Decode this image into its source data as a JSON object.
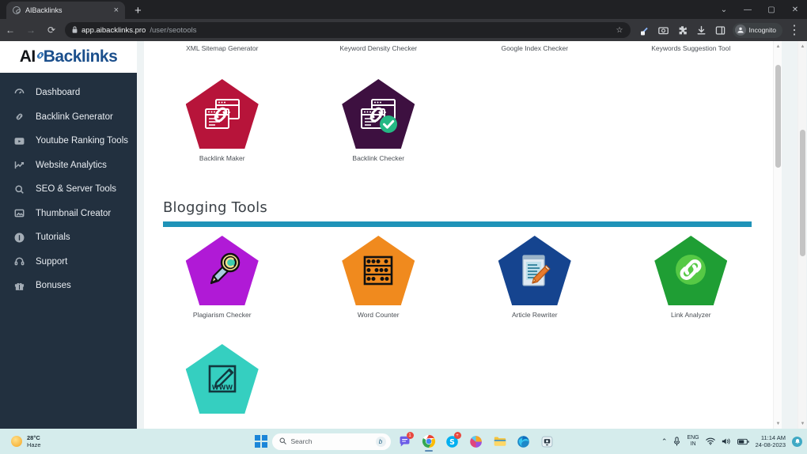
{
  "browser": {
    "tab": {
      "title": "AIBacklinks",
      "favicon_icon": "link-favicon",
      "close_icon": "×"
    },
    "newtab_label": "+",
    "window_controls": [
      {
        "name": "tab-search",
        "glyph": "⌄"
      },
      {
        "name": "minimize",
        "glyph": "—"
      },
      {
        "name": "maximize",
        "glyph": "▢"
      },
      {
        "name": "close",
        "glyph": "✕"
      }
    ],
    "nav": {
      "back": "←",
      "forward": "→",
      "reload": "⟳"
    },
    "omnibox": {
      "lock_icon": "🔒",
      "host": "app.aibacklinks.pro",
      "path": "/user/seotools",
      "star_icon": "☆"
    },
    "toolbar_icons": [
      {
        "name": "edit-pencil-icon",
        "glyph": "✎"
      },
      {
        "name": "camera-icon",
        "glyph": "▣"
      },
      {
        "name": "extensions-puzzle-icon",
        "glyph": "✦"
      },
      {
        "name": "downloads-icon",
        "glyph": "⤓"
      },
      {
        "name": "split-screen-icon",
        "glyph": "▯"
      }
    ],
    "incognito": {
      "label": "Incognito",
      "avatar_icon": "incognito-avatar"
    },
    "menu_icon": "⋮"
  },
  "app": {
    "brand": {
      "prefix": "AI",
      "chain_icon": "link-chain-icon",
      "suffix": "Backlinks"
    },
    "sidebar": {
      "items": [
        {
          "label": "Dashboard",
          "icon": "dashboard-icon"
        },
        {
          "label": "Backlink Generator",
          "icon": "link-icon"
        },
        {
          "label": "Youtube Ranking Tools",
          "icon": "video-icon"
        },
        {
          "label": "Website Analytics",
          "icon": "chart-line-icon"
        },
        {
          "label": "SEO & Server Tools",
          "icon": "search-icon"
        },
        {
          "label": "Thumbnail Creator",
          "icon": "image-icon"
        },
        {
          "label": "Tutorials",
          "icon": "info-icon"
        },
        {
          "label": "Support",
          "icon": "headset-icon"
        },
        {
          "label": "Bonuses",
          "icon": "gift-icon"
        }
      ]
    },
    "seo_tools_labels": [
      "XML Sitemap Generator",
      "Keyword Density Checker",
      "Google Index Checker",
      "Keywords Suggestion Tool"
    ],
    "backlink_tiles": [
      {
        "label": "Backlink Maker",
        "color": "#b7143a",
        "icon": "backlink-maker-icon"
      },
      {
        "label": "Backlink Checker",
        "color": "#3d1040",
        "icon": "backlink-checker-icon",
        "badge_color": "#25b884"
      }
    ],
    "blogging_section": {
      "title": "Blogging Tools",
      "rule_color": "#1f93b8",
      "tiles": [
        {
          "label": "Plagiarism Checker",
          "color": "#b01ad6",
          "icon": "magnifier-pencil-icon"
        },
        {
          "label": "Word Counter",
          "color": "#f08a1e",
          "icon": "abacus-icon"
        },
        {
          "label": "Article Rewriter",
          "color": "#15448f",
          "icon": "document-pencil-icon"
        },
        {
          "label": "Link Analyzer",
          "color": "#1f9e34",
          "icon": "chain-circle-icon"
        },
        {
          "label": "",
          "color": "#35cfc0",
          "icon": "pencil-www-icon"
        }
      ]
    }
  },
  "taskbar": {
    "weather": {
      "temperature": "28°C",
      "condition": "Haze",
      "icon": "sun-icon"
    },
    "start_icon": "windows-logo",
    "search": {
      "placeholder": "Search",
      "icon": "search-icon",
      "bing_icon": "bing-icon"
    },
    "apps": [
      {
        "name": "chat-teams-icon",
        "badge": "1"
      },
      {
        "name": "google-chrome-icon",
        "badge": ""
      },
      {
        "name": "skype-icon",
        "badge": "+"
      },
      {
        "name": "colorful-swirl-icon",
        "badge": ""
      },
      {
        "name": "file-explorer-icon",
        "badge": ""
      },
      {
        "name": "microsoft-edge-icon",
        "badge": ""
      },
      {
        "name": "media-player-icon",
        "badge": ""
      }
    ],
    "tray": {
      "overflow_icon": "⌃",
      "mic_icon": "mic-icon",
      "language": {
        "line1": "ENG",
        "line2": "IN"
      },
      "wifi_icon": "wifi-icon",
      "volume_icon": "volume-icon",
      "battery_icon": "battery-icon",
      "time": "11:14 AM",
      "date": "24-08-2023",
      "notification_badge": "notification-icon"
    }
  }
}
